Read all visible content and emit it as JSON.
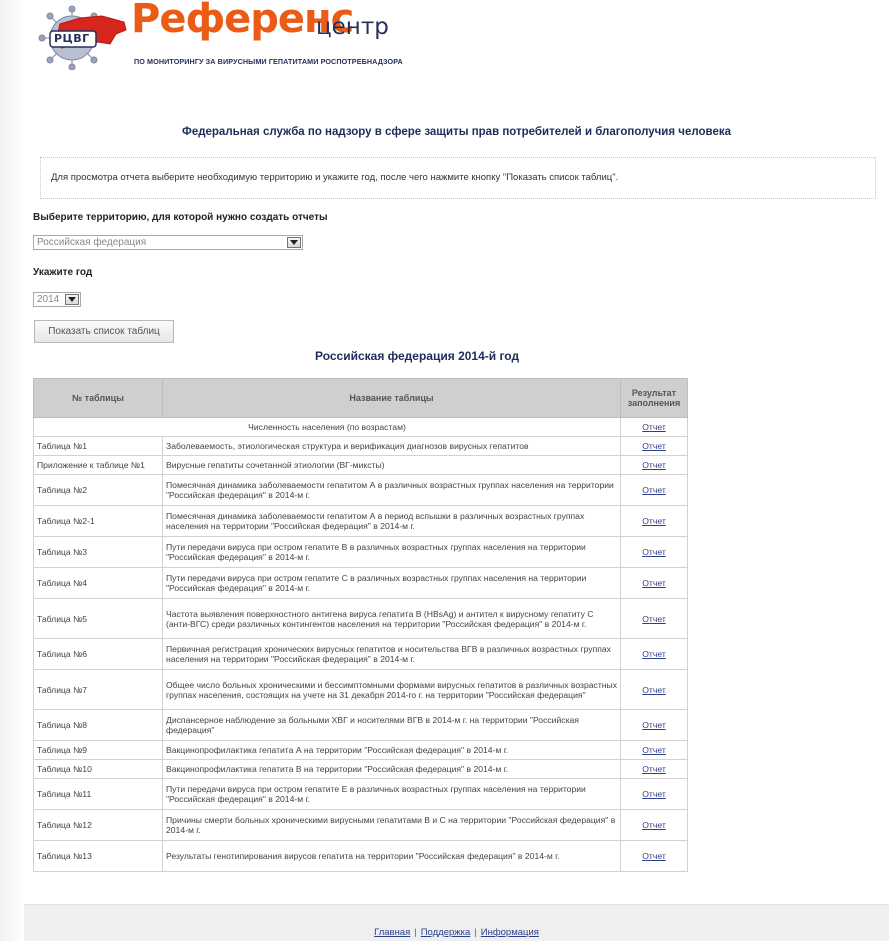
{
  "header": {
    "brand_main": "Референс",
    "brand_suffix": "центр",
    "brand_subtitle": "ПО МОНИТОРИНГУ ЗА ВИРУСНЫМИ ГЕПАТИТАМИ РОСПОТРЕБНАДЗОРА",
    "logo_text": "РЦВГ",
    "colors": {
      "brand_orange": "#ea5b16",
      "brand_navy": "#26305c"
    }
  },
  "org_title": "Федеральная служба по надзору в сфере защиты прав потребителей и благополучия человека",
  "instructions": "Для просмотра отчета выберите необходимую территорию и укажите год, после чего нажмите кнопку \"Показать список таблиц\".",
  "territory": {
    "label": "Выберите территорию, для которой нужно создать отчеты",
    "selected": "Российская федерация"
  },
  "year": {
    "label": "Укажите год",
    "selected": "2014"
  },
  "show_button": "Показать список таблиц",
  "report_title": "Российская федерация 2014-й год",
  "table": {
    "headers": {
      "num": "№ таблицы",
      "name": "Название таблицы",
      "result": "Результат заполнения"
    },
    "population_row": {
      "name": "Численность населения (по возрастам)",
      "result": "Отчет"
    },
    "rows": [
      {
        "num": "Таблица №1",
        "name": "Заболеваемость, этиологическая структура и верификация диагнозов вирусных гепатитов",
        "result": "Отчет"
      },
      {
        "num": "Приложение к таблице №1",
        "name": "Вирусные гепатиты сочетанной этиологии (ВГ-миксты)",
        "result": "Отчет"
      },
      {
        "num": "Таблица №2",
        "name": "Помесячная динамика заболеваемости гепатитом А в различных возрастных группах населения на территории \"Российская федерация\" в 2014-м г.",
        "result": "Отчет"
      },
      {
        "num": "Таблица №2-1",
        "name": "Помесячная динамика заболеваемости гепатитом А в период вспышки в различных возрастных группах населения на территории \"Российская федерация\" в 2014-м г.",
        "result": "Отчет"
      },
      {
        "num": "Таблица №3",
        "name": "Пути передачи вируса при остром гепатите В в различных возрастных группах населения на территории \"Российская федерация\" в 2014-м г.",
        "result": "Отчет"
      },
      {
        "num": "Таблица №4",
        "name": "Пути передачи вируса при остром гепатите С в различных возрастных группах населения на территории \"Российская федерация\" в 2014-м г.",
        "result": "Отчет"
      },
      {
        "num": "Таблица №5",
        "name": "Частота выявления поверхностного антигена вируса гепатита В (HBsAg) и антител к вирусному гепатиту С (анти-ВГС) среди различных контингентов населения на территории \"Российская федерация\" в 2014-м г.",
        "result": "Отчет"
      },
      {
        "num": "Таблица №6",
        "name": "Первичная регистрация хронических вирусных гепатитов и носительства ВГВ в различных возрастных группах населения на территории \"Российская федерация\" в 2014-м г.",
        "result": "Отчет"
      },
      {
        "num": "Таблица №7",
        "name": "Общее число больных хроническими и бессимптомными формами вирусных гепатитов в различных возрастных группах населения, состоящих на учете на 31 декабря 2014-го г. на территории \"Российская федерация\"",
        "result": "Отчет"
      },
      {
        "num": "Таблица №8",
        "name": "Диспансерное наблюдение за больными ХВГ и носителями ВГВ в 2014-м г. на территории \"Российская федерация\"",
        "result": "Отчет"
      },
      {
        "num": "Таблица №9",
        "name": "Вакцинопрофилактика гепатита А на территории \"Российская федерация\" в 2014-м г.",
        "result": "Отчет"
      },
      {
        "num": "Таблица №10",
        "name": "Вакцинопрофилактика гепатита В на территории \"Российская федерация\" в 2014-м г.",
        "result": "Отчет"
      },
      {
        "num": "Таблица №11",
        "name": "Пути передачи вируса при остром гепатите Е в различных возрастных группах населения на территории \"Российская федерация\" в 2014-м г.",
        "result": "Отчет"
      },
      {
        "num": "Таблица №12",
        "name": "Причины смерти больных хроническими вирусными гепатитами В и С на территории \"Российская федерация\" в 2014-м г.",
        "result": "Отчет"
      },
      {
        "num": "Таблица №13",
        "name": "Результаты генотипирования вирусов гепатита на территории \"Российская федерация\" в 2014-м г.",
        "result": "Отчет"
      }
    ]
  },
  "footer": {
    "links": [
      "Главная",
      "Поддержка",
      "Информация"
    ],
    "separator": "|"
  }
}
